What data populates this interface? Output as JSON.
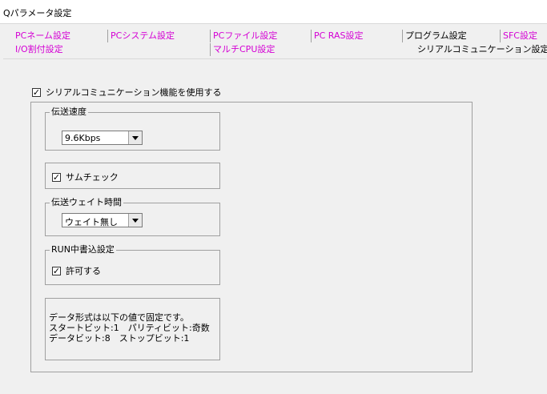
{
  "window": {
    "title": "Qパラメータ設定"
  },
  "tabs": {
    "row1": [
      {
        "label": "PCネーム設定"
      },
      {
        "label": "PCシステム設定"
      },
      {
        "label": "PCファイル設定"
      },
      {
        "label": "PC RAS設定"
      },
      {
        "label": "プログラム設定"
      },
      {
        "label": "SFC設定"
      }
    ],
    "row2": [
      {
        "label": "I/O割付設定"
      },
      {
        "label": "マルチCPU設定"
      },
      {
        "label": "シリアルコミュニケーション設定"
      }
    ]
  },
  "serial": {
    "enable_label": "シリアルコミュニケーション機能を使用する",
    "enable_checked": "✓",
    "speed": {
      "legend": "伝送速度",
      "value": "9.6Kbps"
    },
    "sumcheck": {
      "label": "サムチェック",
      "checked": "✓"
    },
    "wait": {
      "legend": "伝送ウェイト時間",
      "value": "ウェイト無し"
    },
    "run_write": {
      "legend": "RUN中書込設定",
      "label": "許可する",
      "checked": "✓"
    },
    "note": {
      "line1": "データ形式は以下の値で固定です。",
      "line2": "スタートビット:1　パリティビット:奇数",
      "line3": "データビット:8　ストップビット:1"
    }
  }
}
